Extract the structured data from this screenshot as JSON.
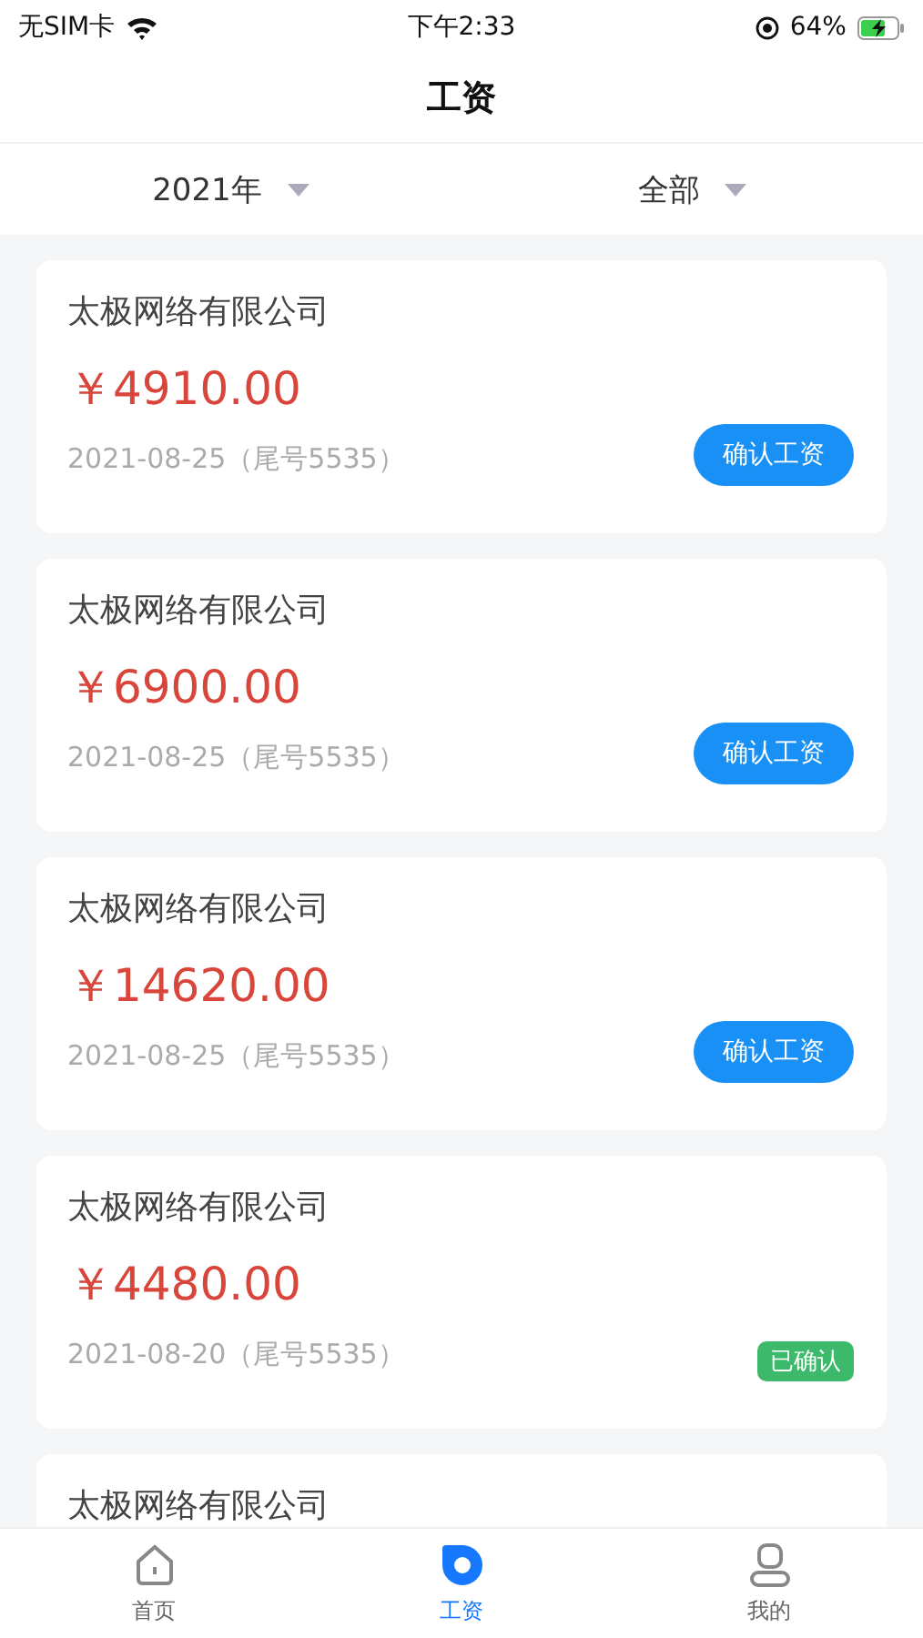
{
  "status_bar": {
    "carrier": "无SIM卡",
    "time": "下午2:33",
    "battery": "64%"
  },
  "nav": {
    "title": "工资"
  },
  "filters": [
    {
      "label": "2021年"
    },
    {
      "label": "全部"
    }
  ],
  "cards": [
    {
      "company": "太极网络有限公司",
      "amount": "￥4910.00",
      "date": "2021-08-25（尾号5535）",
      "status": {
        "kind": "button",
        "label": "确认工资"
      }
    },
    {
      "company": "太极网络有限公司",
      "amount": "￥6900.00",
      "date": "2021-08-25（尾号5535）",
      "status": {
        "kind": "button",
        "label": "确认工资"
      }
    },
    {
      "company": "太极网络有限公司",
      "amount": "￥14620.00",
      "date": "2021-08-25（尾号5535）",
      "status": {
        "kind": "button",
        "label": "确认工资"
      }
    },
    {
      "company": "太极网络有限公司",
      "amount": "￥4480.00",
      "date": "2021-08-20（尾号5535）",
      "status": {
        "kind": "tag",
        "label": "已确认"
      }
    },
    {
      "company": "太极网络有限公司"
    }
  ],
  "tabs": [
    {
      "label": "首页",
      "selected": false
    },
    {
      "label": "工资",
      "selected": true
    },
    {
      "label": "我的",
      "selected": false
    }
  ]
}
